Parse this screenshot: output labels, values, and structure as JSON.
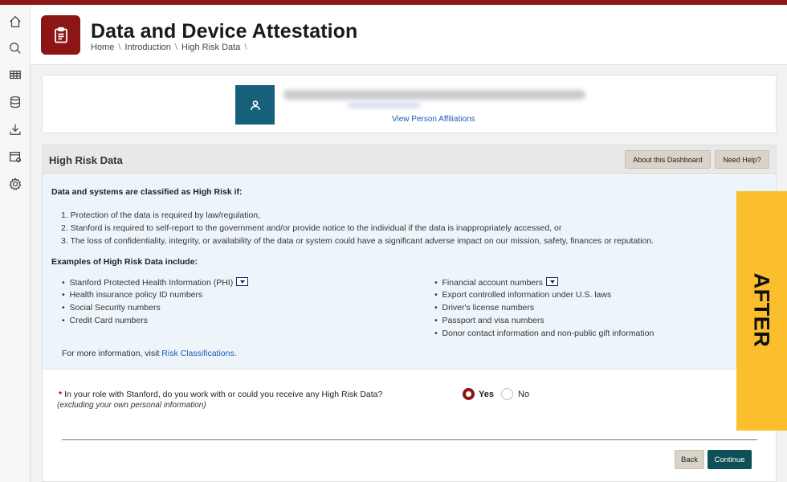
{
  "colors": {
    "brand": "#8c1515",
    "avatar_bg": "#17607a",
    "link": "#1e5bb8",
    "primary_button": "#0f5056",
    "secondary_button": "#d9d4c7",
    "info_bg": "#eef5fa",
    "after_tag": "#fbbf2d"
  },
  "rail": {
    "icons": [
      "home-icon",
      "search-icon",
      "table-icon",
      "database-icon",
      "download-icon",
      "calendar-settings-icon",
      "gear-icon"
    ]
  },
  "header": {
    "icon": "clipboard-icon",
    "title": "Data and Device Attestation",
    "breadcrumbs": [
      "Home",
      "Introduction",
      "High Risk Data"
    ],
    "separator": "\\"
  },
  "person": {
    "avatar_icon": "user-icon",
    "affiliations_link": "View Person Affiliations"
  },
  "panel": {
    "title": "High Risk Data",
    "about_button": "About this Dashboard",
    "help_button": "Need Help?",
    "criteria_heading": "Data and systems are classified as High Risk if:",
    "criteria": [
      "1. Protection of the data is required by law/regulation,",
      "2. Stanford is required to self-report to the government and/or provide notice to the individual if the data is inappropriately accessed, or",
      "3. The loss of confidentiality, integrity, or availability of the data or system could have a significant adverse impact on our mission, safety, finances or reputation."
    ],
    "examples_heading": "Examples of High Risk Data include:",
    "examples_left": [
      "Stanford Protected Health Information (PHI)",
      "Health insurance policy ID numbers",
      "Social Security numbers",
      "Credit Card numbers"
    ],
    "examples_right": [
      "Financial account numbers",
      "Export controlled information under U.S. laws",
      "Driver's license numbers",
      "Passport and visa numbers",
      "Donor contact information and non-public gift information"
    ],
    "more_info_prefix": "For more information, visit ",
    "more_info_link": "Risk Classifications."
  },
  "question": {
    "required_mark": "*",
    "text": "In your role with Stanford, do you work with or could you receive any High Risk Data?",
    "subtext": "(excluding your own personal information)",
    "options": [
      "Yes",
      "No"
    ],
    "selected": "Yes"
  },
  "actions": {
    "back": "Back",
    "continue": "Continue"
  },
  "overlay_tag": "AFTER"
}
